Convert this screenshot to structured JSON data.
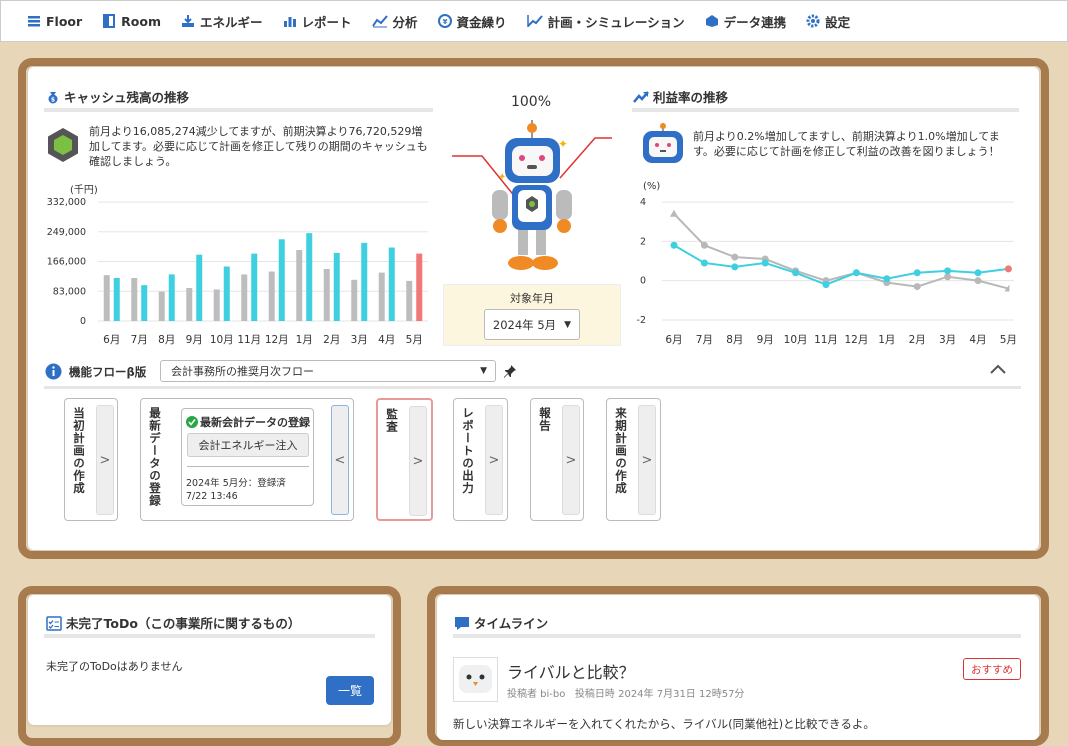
{
  "nav": [
    {
      "label": "Floor",
      "icon": "floor-icon"
    },
    {
      "label": "Room",
      "icon": "room-icon"
    },
    {
      "label": "エネルギー",
      "icon": "energy-icon"
    },
    {
      "label": "レポート",
      "icon": "report-icon"
    },
    {
      "label": "分析",
      "icon": "analysis-icon"
    },
    {
      "label": "資金繰り",
      "icon": "cashflow-icon"
    },
    {
      "label": "計画・シミュレーション",
      "icon": "plan-icon"
    },
    {
      "label": "データ連携",
      "icon": "data-link-icon"
    },
    {
      "label": "設定",
      "icon": "gear-icon"
    }
  ],
  "cash": {
    "title": "キャッシュ残高の推移",
    "message": "前月より16,085,274減少してますが、前期決算より76,720,529増加してます。必要に応じて計画を修正して残りの期間のキャッシュも確認しましょう。",
    "unit": "(千円)"
  },
  "robot": {
    "percent": "100%",
    "period_label": "対象年月",
    "period_value": "2024年 5月"
  },
  "profit": {
    "title": "利益率の推移",
    "message": "前月より0.2%増加してますし、前期決算より1.0%増加してます。必要に応じて計画を修正して利益の改善を図りましょう！",
    "unit": "(%)"
  },
  "flow": {
    "title": "機能フローβ版",
    "select_value": "会計事務所の推奨月次フロー",
    "cards": [
      "当初計画の作成",
      "最新データの登録",
      "監査",
      "レポートの出力",
      "報告",
      "来期計画の作成"
    ],
    "step_title": "最新会計データの登録",
    "step_button": "会計エネルギー注入",
    "step_status": "2024年 5月分：登録済",
    "step_time": "7/22 13:46"
  },
  "todo": {
    "title": "未完了ToDo（この事業所に関するもの）",
    "empty": "未完了のToDoはありません",
    "button": "一覧"
  },
  "timeline": {
    "title": "タイムライン",
    "post_title": "ライバルと比較？",
    "post_meta": "投稿者 bi-bo   投稿日時 2024年 7月31日 12時57分",
    "badge": "おすすめ",
    "post_body": "新しい決算エネルギーを入れてくれたから、ライバル(同業他社)と比較できるよ。"
  },
  "colors": {
    "bar_current": "#3ecfe0",
    "bar_prev": "#bdbdbd",
    "bar_latest": "#f07878",
    "accent": "#2f6fc6",
    "frame": "#a77b4e"
  },
  "chart_data": [
    {
      "type": "bar",
      "title": "キャッシュ残高の推移",
      "ylabel": "(千円)",
      "categories": [
        "6月",
        "7月",
        "8月",
        "9月",
        "10月",
        "11月",
        "12月",
        "1月",
        "2月",
        "3月",
        "4月",
        "5月"
      ],
      "yticks": [
        "332,000",
        "249,000",
        "166,000",
        "83,000",
        "0"
      ],
      "ylim": [
        0,
        332000
      ],
      "series": [
        {
          "values": [
            128000,
            120000,
            82000,
            92000,
            88000,
            130000,
            138000,
            198000,
            145000,
            115000,
            135000,
            112000
          ]
        },
        {
          "values": [
            120000,
            100000,
            130000,
            185000,
            152000,
            188000,
            228000,
            245000,
            190000,
            218000,
            205000,
            188000
          ]
        }
      ]
    },
    {
      "type": "line",
      "title": "利益率の推移",
      "ylabel": "(%)",
      "categories": [
        "6月",
        "7月",
        "8月",
        "9月",
        "10月",
        "11月",
        "12月",
        "1月",
        "2月",
        "3月",
        "4月",
        "5月"
      ],
      "yticks": [
        "4",
        "2",
        "0",
        "-2"
      ],
      "ylim": [
        -2,
        4
      ],
      "series": [
        {
          "values": [
            1.8,
            0.9,
            0.7,
            0.9,
            0.4,
            -0.2,
            0.4,
            0.1,
            0.4,
            0.5,
            0.4,
            0.6
          ]
        },
        {
          "values": [
            3.4,
            1.8,
            1.2,
            1.1,
            0.5,
            0.0,
            0.4,
            -0.1,
            -0.3,
            0.2,
            0.0,
            -0.4
          ]
        }
      ]
    }
  ]
}
